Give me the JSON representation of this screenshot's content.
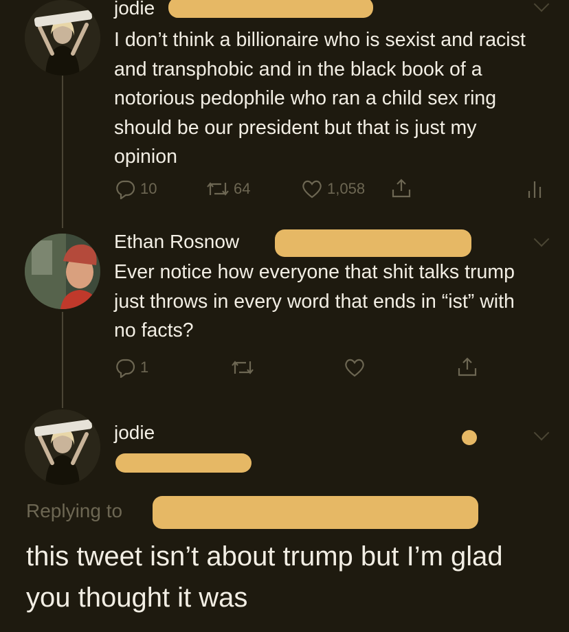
{
  "tweets": [
    {
      "name": "jodie",
      "text": "I don’t think a billionaire who is sexist and racist and transphobic and in the black book of a notorious pedophile who ran a child sex ring should be our president but that is just my opinion",
      "replies": "10",
      "retweets": "64",
      "likes": "1,058"
    },
    {
      "name": "Ethan Rosnow",
      "text": "Ever notice how everyone that shit talks trump just throws in every word that ends in “ist” with no facts?",
      "replies": "1"
    },
    {
      "name": "jodie"
    }
  ],
  "reply": {
    "replying_to": "Replying to",
    "text": "this tweet isn’t about trump but I’m glad you thought it was"
  },
  "colors": {
    "background": "#1e1a0f",
    "redaction": "#e6b865",
    "muted": "#6d6753"
  },
  "icons": [
    "reply-icon",
    "retweet-icon",
    "like-icon",
    "share-icon",
    "analytics-icon",
    "chevron-down-icon"
  ]
}
